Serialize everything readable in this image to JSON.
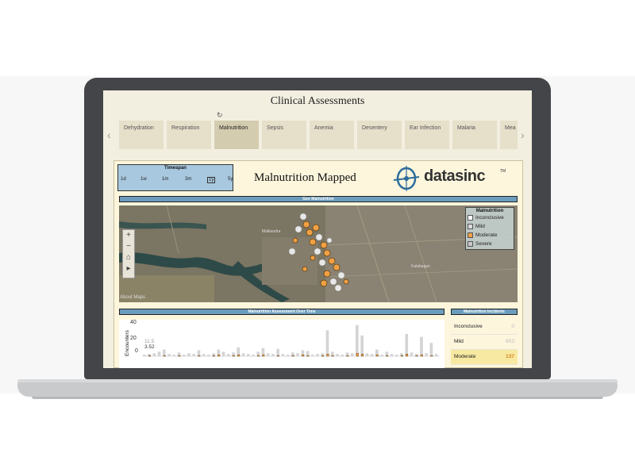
{
  "app": {
    "title": "Clinical Assessments"
  },
  "tabs": [
    {
      "label": "Dehydration"
    },
    {
      "label": "Respiration"
    },
    {
      "label": "Malnutrition",
      "active": true
    },
    {
      "label": "Sepsis"
    },
    {
      "label": "Anemia"
    },
    {
      "label": "Desentery"
    },
    {
      "label": "Ear Infection"
    },
    {
      "label": "Malaria"
    },
    {
      "label": "Mea"
    }
  ],
  "timespan": {
    "title": "Timespan",
    "options": [
      "1d",
      "1w",
      "1m",
      "3m",
      "1y",
      "5y"
    ],
    "selected": "1y"
  },
  "dashboard": {
    "title": "Malnutrition Mapped"
  },
  "logo": {
    "text": "datasinc",
    "tm": "TM"
  },
  "map": {
    "panel_title": "Geo Malnutrition",
    "about": "About Maps",
    "legend_title": "Malnutrition",
    "legend": [
      {
        "label": "Inconclusive",
        "color": "#ffffff"
      },
      {
        "label": "Mild",
        "color": "#d8d8d8"
      },
      {
        "label": "Moderate",
        "color": "#f0a044"
      },
      {
        "label": "Severe",
        "color": "#c8c8c8"
      }
    ],
    "place_labels": [
      "Malkandra",
      "Kalabagan"
    ]
  },
  "chart": {
    "panel_title": "Malnutrition Assessment Over Time",
    "ylabel": "Encounters",
    "yticks": [
      "40",
      "20",
      "0"
    ],
    "annotations": [
      "11.5",
      "3.52"
    ]
  },
  "chart_data": {
    "type": "bar",
    "ylabel": "Encounters",
    "ylim": [
      0,
      45
    ],
    "series": [
      {
        "name": "Mild",
        "color": "#d4d4d4",
        "values": [
          2,
          3,
          4,
          6,
          9,
          3,
          2,
          5,
          2,
          4,
          3,
          8,
          3,
          2,
          4,
          9,
          6,
          3,
          5,
          12,
          4,
          3,
          2,
          6,
          11,
          4,
          3,
          10,
          3,
          2,
          5,
          4,
          8,
          7,
          2,
          3,
          4,
          35,
          6,
          3,
          2,
          5,
          4,
          42,
          28,
          4,
          3,
          9,
          2,
          6,
          3,
          2,
          4,
          30,
          5,
          3,
          26,
          4,
          18,
          3
        ]
      },
      {
        "name": "Moderate",
        "color": "#f0a044",
        "values": [
          0,
          1,
          0,
          0,
          1,
          0,
          0,
          1,
          0,
          0,
          0,
          1,
          0,
          0,
          1,
          2,
          0,
          0,
          1,
          2,
          0,
          0,
          0,
          1,
          2,
          0,
          0,
          1,
          0,
          0,
          1,
          0,
          2,
          1,
          0,
          0,
          1,
          3,
          1,
          0,
          0,
          1,
          0,
          4,
          3,
          0,
          0,
          2,
          0,
          1,
          0,
          0,
          1,
          3,
          0,
          1,
          2,
          0,
          1,
          0
        ]
      }
    ]
  },
  "incidents": {
    "panel_title": "Malnutrition Incidents",
    "rows": [
      {
        "label": "Inconclusive",
        "value": "0"
      },
      {
        "label": "Mild",
        "value": "653"
      },
      {
        "label": "Moderate",
        "value": "137"
      }
    ]
  },
  "colors": {
    "accent": "#6b9cbc",
    "moderate": "#f0a044",
    "panel": "#fdf6dd"
  },
  "icons": [
    "chevron-left-icon",
    "chevron-right-icon",
    "reload-icon",
    "zoom-in-icon",
    "zoom-out-icon",
    "home-icon",
    "play-icon"
  ]
}
